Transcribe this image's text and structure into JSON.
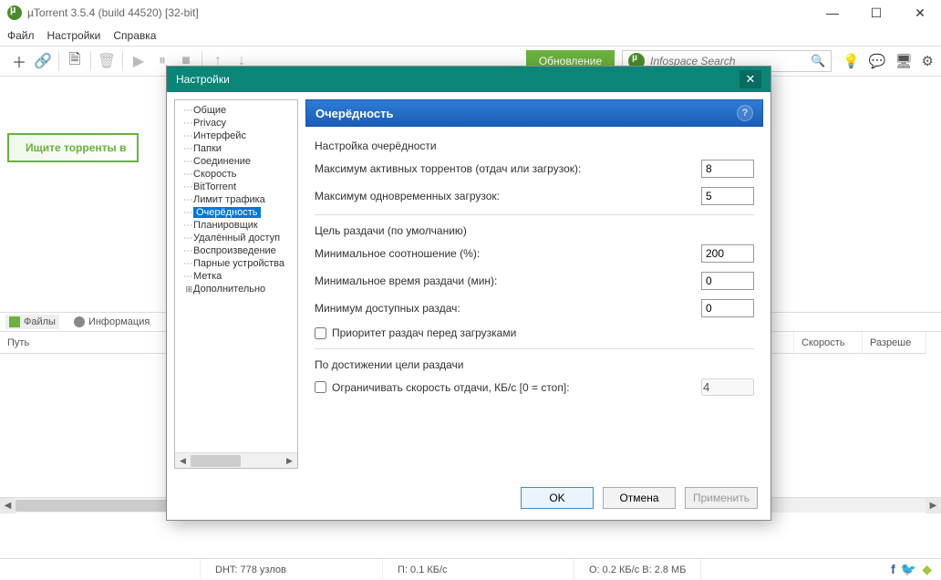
{
  "window": {
    "title": "µTorrent 3.5.4  (build 44520) [32-bit]"
  },
  "menu": {
    "file": "Файл",
    "settings": "Настройки",
    "help": "Справка"
  },
  "toolbar": {
    "update_btn": "Обновление",
    "search_placeholder": "Infospace Search"
  },
  "hint_button": "Ищите торренты в",
  "bottom_tabs": {
    "files": "Файлы",
    "info": "Информация"
  },
  "table": {
    "path": "Путь",
    "speed": "Скорость",
    "resolve": "Разреше"
  },
  "status": {
    "dht": "DHT: 778 узлов",
    "down": "П: 0.1 КБ/с",
    "up": "О: 0.2 КБ/с В: 2.8 МБ"
  },
  "dialog": {
    "title": "Настройки",
    "tree": [
      "Общие",
      "Privacy",
      "Интерфейс",
      "Папки",
      "Соединение",
      "Скорость",
      "BitTorrent",
      "Лимит трафика",
      "Очерёдность",
      "Планировщик",
      "Удалённый доступ",
      "Воспроизведение",
      "Парные устройства",
      "Метка",
      "Дополнительно"
    ],
    "selected_index": 8,
    "panel_title": "Очерёдность",
    "group1_title": "Настройка очерёдности",
    "max_active_label": "Максимум активных торрентов (отдач или загрузок):",
    "max_active_value": "8",
    "max_dl_label": "Максимум одновременных загрузок:",
    "max_dl_value": "5",
    "group2_title": "Цель раздачи (по умолчанию)",
    "min_ratio_label": "Минимальное соотношение (%):",
    "min_ratio_value": "200",
    "min_time_label": "Минимальное время раздачи (мин):",
    "min_time_value": "0",
    "min_avail_label": "Минимум доступных раздач:",
    "min_avail_value": "0",
    "priority_checkbox": "Приоритет раздач перед загрузками",
    "group3_title": "По достижении цели раздачи",
    "limit_checkbox": "Ограничивать скорость отдачи, КБ/с [0 = стоп]:",
    "limit_value": "4",
    "btn_ok": "OK",
    "btn_cancel": "Отмена",
    "btn_apply": "Применить"
  }
}
